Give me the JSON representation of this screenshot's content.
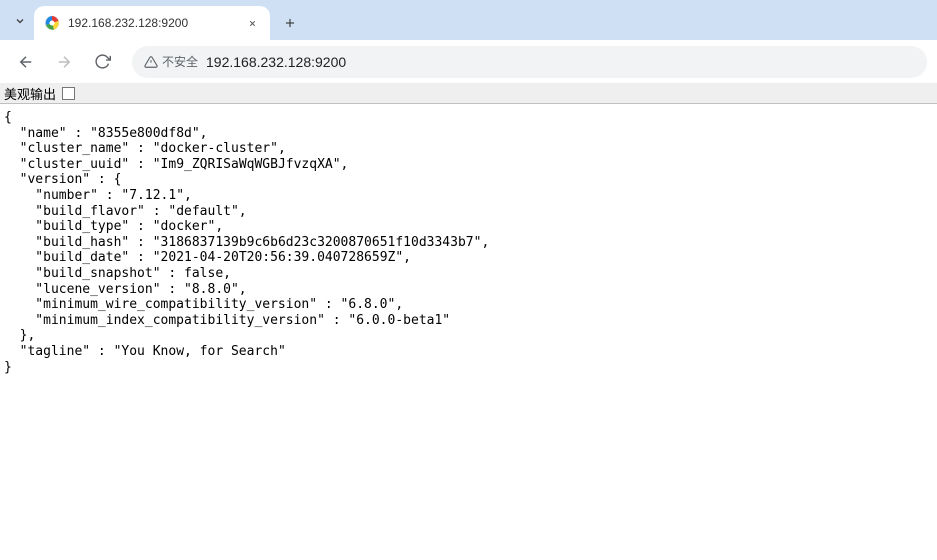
{
  "tab": {
    "title": "192.168.232.128:9200"
  },
  "address": {
    "security_label": "不安全",
    "url": "192.168.232.128:9200"
  },
  "pretty_print": {
    "label": "美观输出"
  },
  "response": {
    "name": "8355e800df8d",
    "cluster_name": "docker-cluster",
    "cluster_uuid": "Im9_ZQRISaWqWGBJfvzqXA",
    "version": {
      "number": "7.12.1",
      "build_flavor": "default",
      "build_type": "docker",
      "build_hash": "3186837139b9c6b6d23c3200870651f10d3343b7",
      "build_date": "2021-04-20T20:56:39.040728659Z",
      "build_snapshot": "false",
      "lucene_version": "8.8.0",
      "minimum_wire_compatibility_version": "6.8.0",
      "minimum_index_compatibility_version": "6.0.0-beta1"
    },
    "tagline": "You Know, for Search"
  }
}
